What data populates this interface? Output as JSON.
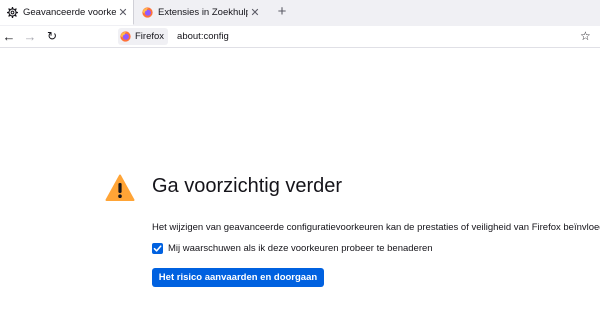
{
  "tabs": [
    {
      "title": "Geavanceerde voorkeuren",
      "icon": "gear-icon",
      "active": true
    },
    {
      "title": "Extensies in Zoekhulpmiddelen",
      "icon": "firefox-icon",
      "active": false
    }
  ],
  "newtab": {
    "icon": "plus-icon",
    "label": "+"
  },
  "toolbar": {
    "back": "←",
    "forward": "→",
    "reload": "↻",
    "identity_label": "Firefox",
    "url": "about:config",
    "bookmark": "☆"
  },
  "warning": {
    "icon": "warning-icon",
    "title": "Ga voorzichtig verder",
    "description": "Het wijzigen van geavanceerde configuratievoorkeuren kan de prestaties of veiligheid van Firefox beïnvloeden.",
    "checkbox_label": "Mij waarschuwen als ik deze voorkeuren probeer te benaderen",
    "checkbox_checked": true,
    "button_label": "Het risico aanvaarden en doorgaan"
  },
  "colors": {
    "accent": "#0061e0",
    "warning": "#ffa436"
  }
}
